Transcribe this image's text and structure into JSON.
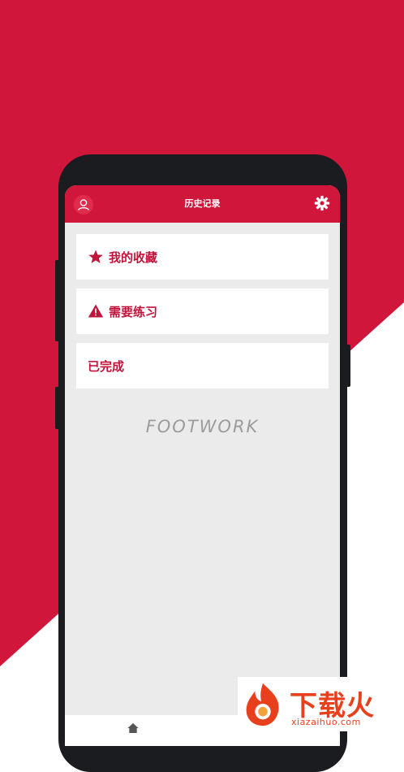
{
  "colors": {
    "brand_red": "#d0163a",
    "watermark_orange": "#e8401c"
  },
  "app": {
    "title": "历史记录",
    "icons": {
      "left": "user-icon",
      "right": "gear-icon"
    }
  },
  "menu": [
    {
      "label": "我的收藏",
      "icon": "star-icon"
    },
    {
      "label": "需要练习",
      "icon": "warning-icon"
    },
    {
      "label": "已完成",
      "icon": ""
    }
  ],
  "brand_text": "FOOTWORK",
  "bottom_nav": {
    "icons": [
      "home-icon"
    ]
  },
  "watermark": {
    "title": "下载火",
    "domain": "xiazaihuo.com"
  }
}
